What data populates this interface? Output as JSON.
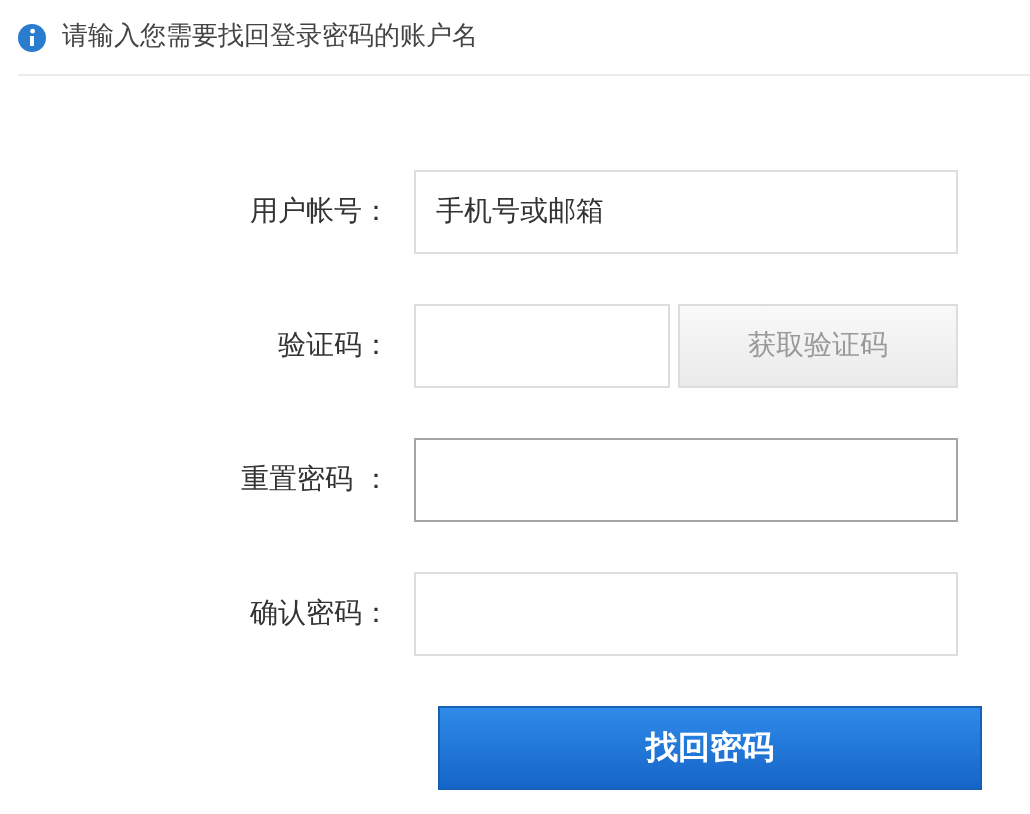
{
  "notice": {
    "text": "请输入您需要找回登录密码的账户名"
  },
  "fields": [
    {
      "kind": "text",
      "label": "用户帐号：",
      "value": "手机号或邮箱",
      "focused": false
    },
    {
      "kind": "code",
      "label": "验证码：",
      "focused": false,
      "button": {
        "label": "获取验证码",
        "disabled": true
      }
    },
    {
      "kind": "password",
      "label": "重置密码 ：",
      "focused": true
    },
    {
      "kind": "password",
      "label": "确认密码：",
      "focused": false
    }
  ],
  "submit": {
    "label": "找回密码"
  }
}
